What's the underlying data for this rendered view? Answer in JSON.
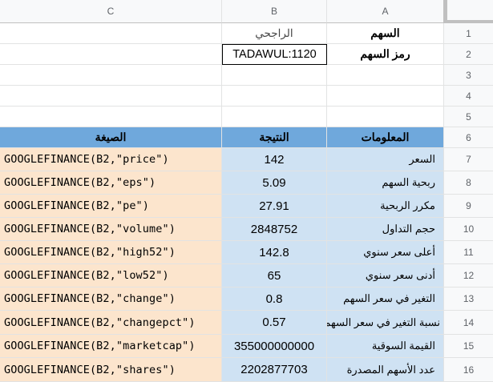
{
  "columns": [
    "C",
    "B",
    "A"
  ],
  "row_numbers": [
    "1",
    "2",
    "3",
    "4",
    "5",
    "6",
    "7",
    "8",
    "9",
    "10",
    "11",
    "12",
    "13",
    "14",
    "15",
    "16"
  ],
  "top": {
    "a1": "السهم",
    "b1": "الراجحي",
    "a2": "رمز السهم",
    "b2": "TADAWUL:1120"
  },
  "table_header": {
    "formula": "الصيغة",
    "result": "النتيجة",
    "info": "المعلومات"
  },
  "table_rows": [
    {
      "formula": "GOOGLEFINANCE(B2,\"price\")",
      "result": "142",
      "info": "السعر"
    },
    {
      "formula": "GOOGLEFINANCE(B2,\"eps\")",
      "result": "5.09",
      "info": "ربحية السهم"
    },
    {
      "formula": "GOOGLEFINANCE(B2,\"pe\")",
      "result": "27.91",
      "info": "مكرر الربحية"
    },
    {
      "formula": "GOOGLEFINANCE(B2,\"volume\")",
      "result": "2848752",
      "info": "حجم التداول"
    },
    {
      "formula": "GOOGLEFINANCE(B2,\"high52\")",
      "result": "142.8",
      "info": "أعلى سعر سنوي"
    },
    {
      "formula": "GOOGLEFINANCE(B2,\"low52\")",
      "result": "65",
      "info": "أدنى سعر سنوي"
    },
    {
      "formula": "GOOGLEFINANCE(B2,\"change\")",
      "result": "0.8",
      "info": "التغير في سعر السهم"
    },
    {
      "formula": "GOOGLEFINANCE(B2,\"changepct\")",
      "result": "0.57",
      "info": "نسبة التغير في سعر السهم"
    },
    {
      "formula": "GOOGLEFINANCE(B2,\"marketcap\")",
      "result": "355000000000",
      "info": "القيمة السوقية"
    },
    {
      "formula": "GOOGLEFINANCE(B2,\"shares\")",
      "result": "2202877703",
      "info": "عدد الأسهم المصدرة"
    }
  ],
  "colors": {
    "header_fill": "#6fa8dc",
    "formula_fill": "#fce5cd",
    "result_fill": "#cfe2f3"
  }
}
